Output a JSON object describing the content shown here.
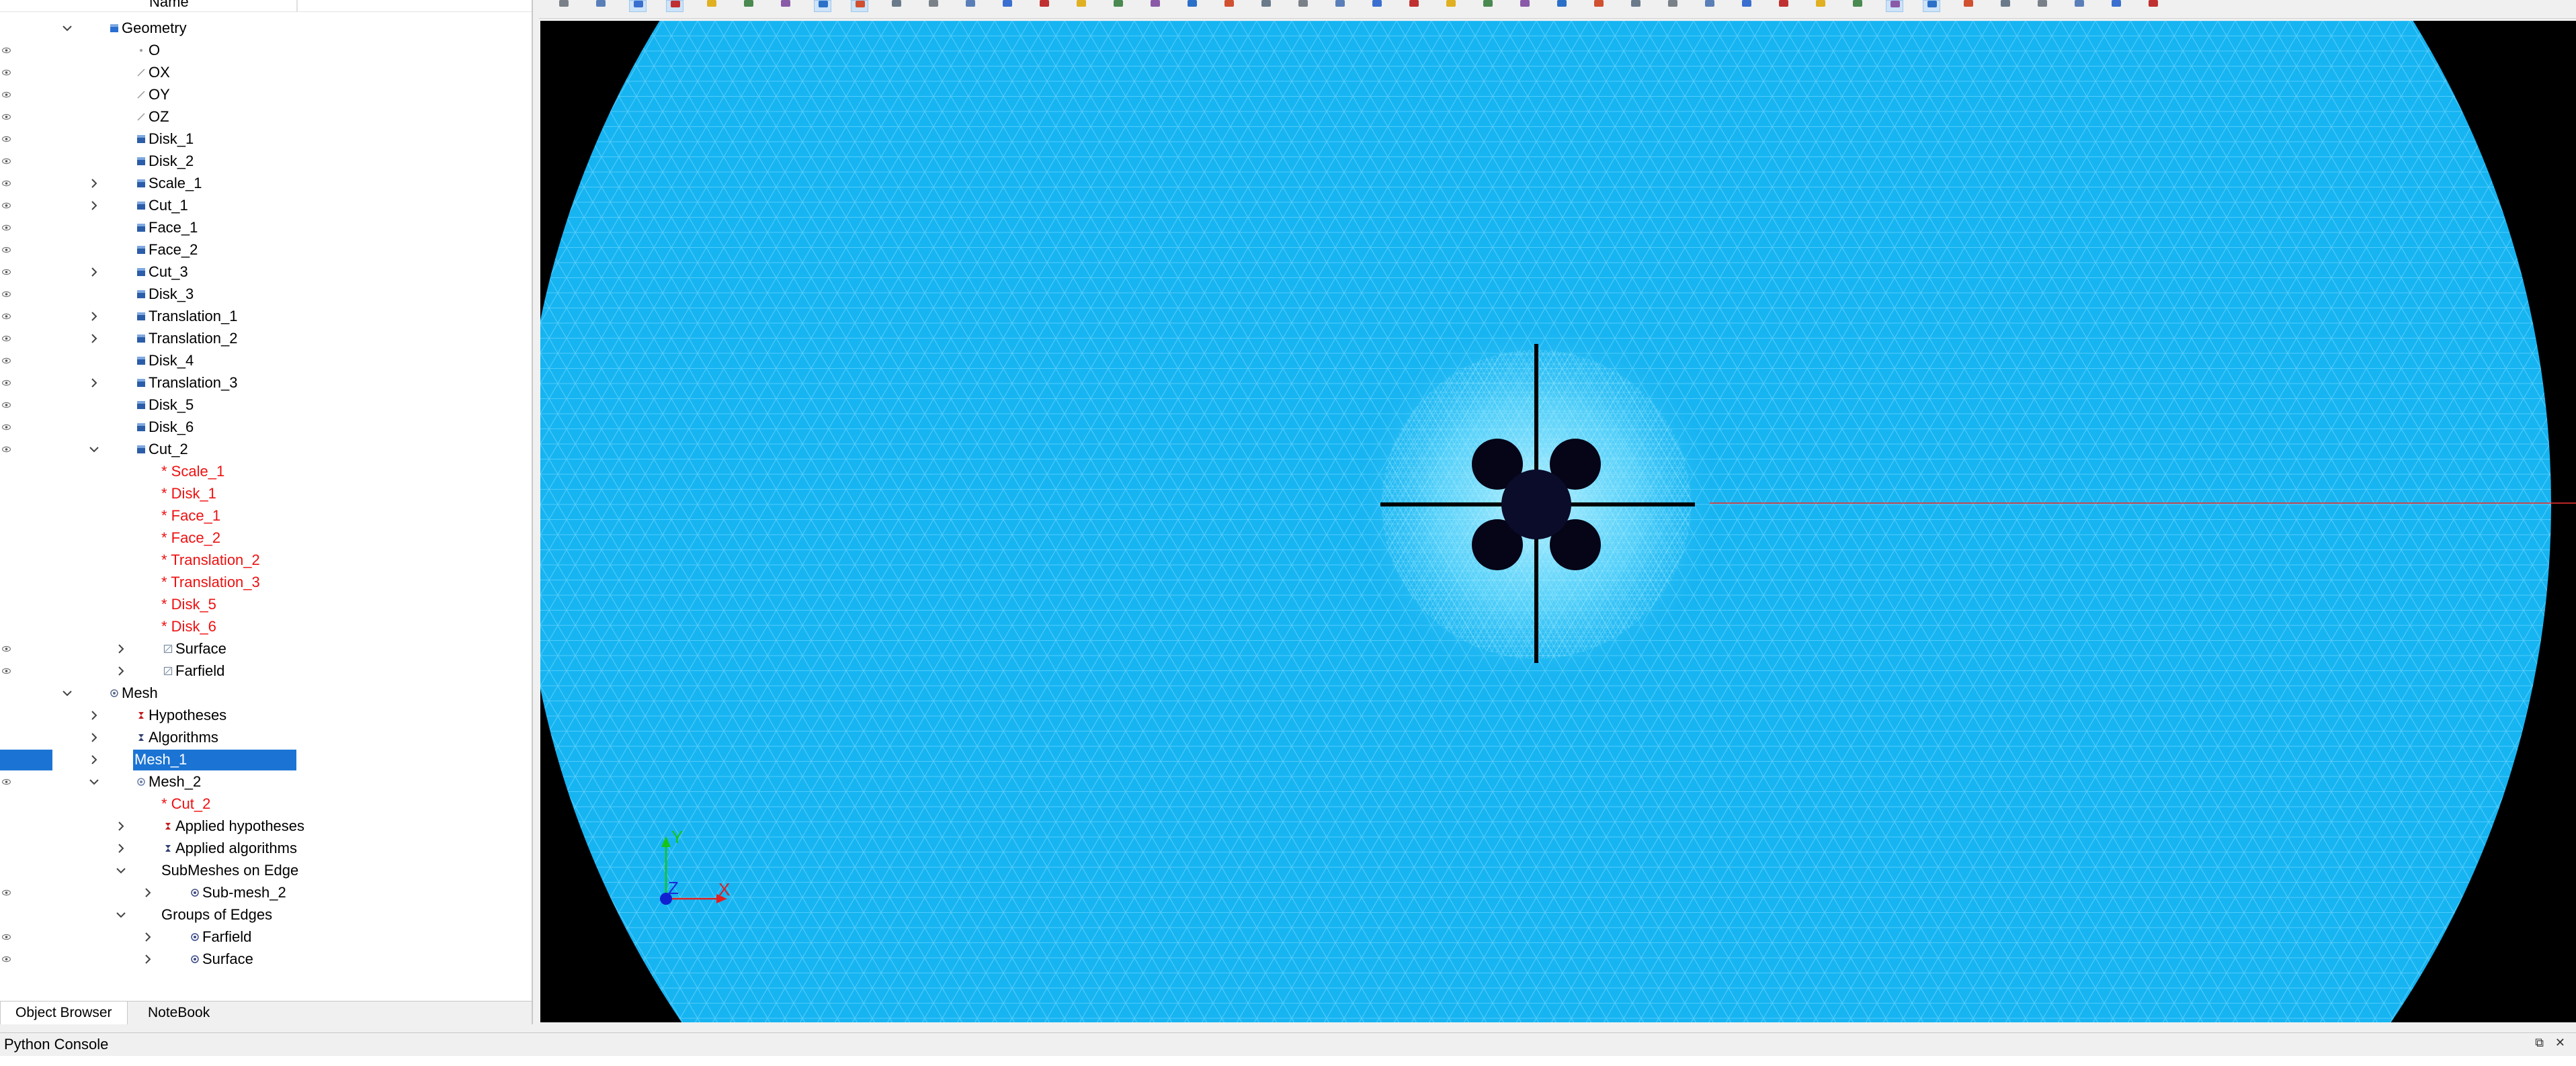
{
  "object_browser": {
    "column_header": "Name",
    "tree": [
      {
        "label": "Geometry",
        "level": 0,
        "expander": "open",
        "icon": "geometry-icon",
        "eye": false,
        "color": "black"
      },
      {
        "label": "O",
        "level": 1,
        "expander": "none",
        "icon": "point-icon",
        "eye": true,
        "color": "black"
      },
      {
        "label": "OX",
        "level": 1,
        "expander": "none",
        "icon": "vector-icon",
        "eye": true,
        "color": "black"
      },
      {
        "label": "OY",
        "level": 1,
        "expander": "none",
        "icon": "vector-icon",
        "eye": true,
        "color": "black"
      },
      {
        "label": "OZ",
        "level": 1,
        "expander": "none",
        "icon": "vector-icon",
        "eye": true,
        "color": "black"
      },
      {
        "label": "Disk_1",
        "level": 1,
        "expander": "none",
        "icon": "shape-icon",
        "eye": true,
        "color": "black"
      },
      {
        "label": "Disk_2",
        "level": 1,
        "expander": "none",
        "icon": "shape-icon",
        "eye": true,
        "color": "black"
      },
      {
        "label": "Scale_1",
        "level": 1,
        "expander": "closed",
        "icon": "shape-icon",
        "eye": true,
        "color": "black"
      },
      {
        "label": "Cut_1",
        "level": 1,
        "expander": "closed",
        "icon": "shape-icon",
        "eye": true,
        "color": "black"
      },
      {
        "label": "Face_1",
        "level": 1,
        "expander": "none",
        "icon": "shape-icon",
        "eye": true,
        "color": "black"
      },
      {
        "label": "Face_2",
        "level": 1,
        "expander": "none",
        "icon": "shape-icon",
        "eye": true,
        "color": "black"
      },
      {
        "label": "Cut_3",
        "level": 1,
        "expander": "closed",
        "icon": "shape-icon",
        "eye": true,
        "color": "black"
      },
      {
        "label": "Disk_3",
        "level": 1,
        "expander": "none",
        "icon": "shape-icon",
        "eye": true,
        "color": "black"
      },
      {
        "label": "Translation_1",
        "level": 1,
        "expander": "closed",
        "icon": "shape-icon",
        "eye": true,
        "color": "black"
      },
      {
        "label": "Translation_2",
        "level": 1,
        "expander": "closed",
        "icon": "shape-icon",
        "eye": true,
        "color": "black"
      },
      {
        "label": "Disk_4",
        "level": 1,
        "expander": "none",
        "icon": "shape-icon",
        "eye": true,
        "color": "black"
      },
      {
        "label": "Translation_3",
        "level": 1,
        "expander": "closed",
        "icon": "shape-icon",
        "eye": true,
        "color": "black"
      },
      {
        "label": "Disk_5",
        "level": 1,
        "expander": "none",
        "icon": "shape-icon",
        "eye": true,
        "color": "black"
      },
      {
        "label": "Disk_6",
        "level": 1,
        "expander": "none",
        "icon": "shape-icon",
        "eye": true,
        "color": "black"
      },
      {
        "label": "Cut_2",
        "level": 1,
        "expander": "open",
        "icon": "shape-icon",
        "eye": true,
        "color": "black"
      },
      {
        "label": "* Scale_1",
        "level": 2,
        "expander": "none",
        "icon": "",
        "eye": false,
        "color": "red"
      },
      {
        "label": "* Disk_1",
        "level": 2,
        "expander": "none",
        "icon": "",
        "eye": false,
        "color": "red"
      },
      {
        "label": "* Face_1",
        "level": 2,
        "expander": "none",
        "icon": "",
        "eye": false,
        "color": "red"
      },
      {
        "label": "* Face_2",
        "level": 2,
        "expander": "none",
        "icon": "",
        "eye": false,
        "color": "red"
      },
      {
        "label": "* Translation_2",
        "level": 2,
        "expander": "none",
        "icon": "",
        "eye": false,
        "color": "red"
      },
      {
        "label": "* Translation_3",
        "level": 2,
        "expander": "none",
        "icon": "",
        "eye": false,
        "color": "red"
      },
      {
        "label": "* Disk_5",
        "level": 2,
        "expander": "none",
        "icon": "",
        "eye": false,
        "color": "red"
      },
      {
        "label": "* Disk_6",
        "level": 2,
        "expander": "none",
        "icon": "",
        "eye": false,
        "color": "red"
      },
      {
        "label": "Surface",
        "level": 2,
        "expander": "closed",
        "icon": "group-icon",
        "eye": true,
        "color": "black"
      },
      {
        "label": "Farfield",
        "level": 2,
        "expander": "closed",
        "icon": "group-icon",
        "eye": true,
        "color": "black"
      },
      {
        "label": "Mesh",
        "level": 0,
        "expander": "open",
        "icon": "mesh-module-icon",
        "eye": false,
        "color": "black"
      },
      {
        "label": "Hypotheses",
        "level": 1,
        "expander": "closed",
        "icon": "hypotheses-icon",
        "eye": false,
        "color": "black"
      },
      {
        "label": "Algorithms",
        "level": 1,
        "expander": "closed",
        "icon": "algorithms-icon",
        "eye": false,
        "color": "black"
      },
      {
        "label": "Mesh_1",
        "level": 1,
        "expander": "closed",
        "icon": "",
        "eye": false,
        "color": "black",
        "selected": true
      },
      {
        "label": "Mesh_2",
        "level": 1,
        "expander": "open",
        "icon": "mesh-icon",
        "eye": true,
        "color": "black"
      },
      {
        "label": "* Cut_2",
        "level": 2,
        "expander": "none",
        "icon": "",
        "eye": false,
        "color": "red"
      },
      {
        "label": "Applied hypotheses",
        "level": 2,
        "expander": "closed",
        "icon": "hypotheses-icon",
        "eye": false,
        "color": "black"
      },
      {
        "label": "Applied algorithms",
        "level": 2,
        "expander": "closed",
        "icon": "algorithms-icon",
        "eye": false,
        "color": "black"
      },
      {
        "label": "SubMeshes on Edge",
        "level": 2,
        "expander": "open",
        "icon": "",
        "eye": false,
        "color": "black"
      },
      {
        "label": "Sub-mesh_2",
        "level": 3,
        "expander": "closed",
        "icon": "submesh-icon",
        "eye": true,
        "color": "black"
      },
      {
        "label": "Groups of Edges",
        "level": 2,
        "expander": "open",
        "icon": "",
        "eye": false,
        "color": "black"
      },
      {
        "label": "Farfield",
        "level": 3,
        "expander": "closed",
        "icon": "mesh-group-icon",
        "eye": true,
        "color": "black"
      },
      {
        "label": "Surface",
        "level": 3,
        "expander": "closed",
        "icon": "mesh-group-icon",
        "eye": true,
        "color": "black"
      }
    ],
    "tabs": [
      {
        "label": "Object Browser",
        "active": true
      },
      {
        "label": "NoteBook",
        "active": false
      }
    ]
  },
  "viewer": {
    "background": "#000000",
    "mesh_fill": "#17b4f2",
    "mesh_edges": "#8ee6ff",
    "axis_labels": {
      "x": "X",
      "y": "Y",
      "z": "Z"
    }
  },
  "console": {
    "title": "Python Console",
    "controls": "⧉ ✕"
  },
  "colors": {
    "selection": "#1b74d4",
    "red_text": "#ee1010"
  }
}
